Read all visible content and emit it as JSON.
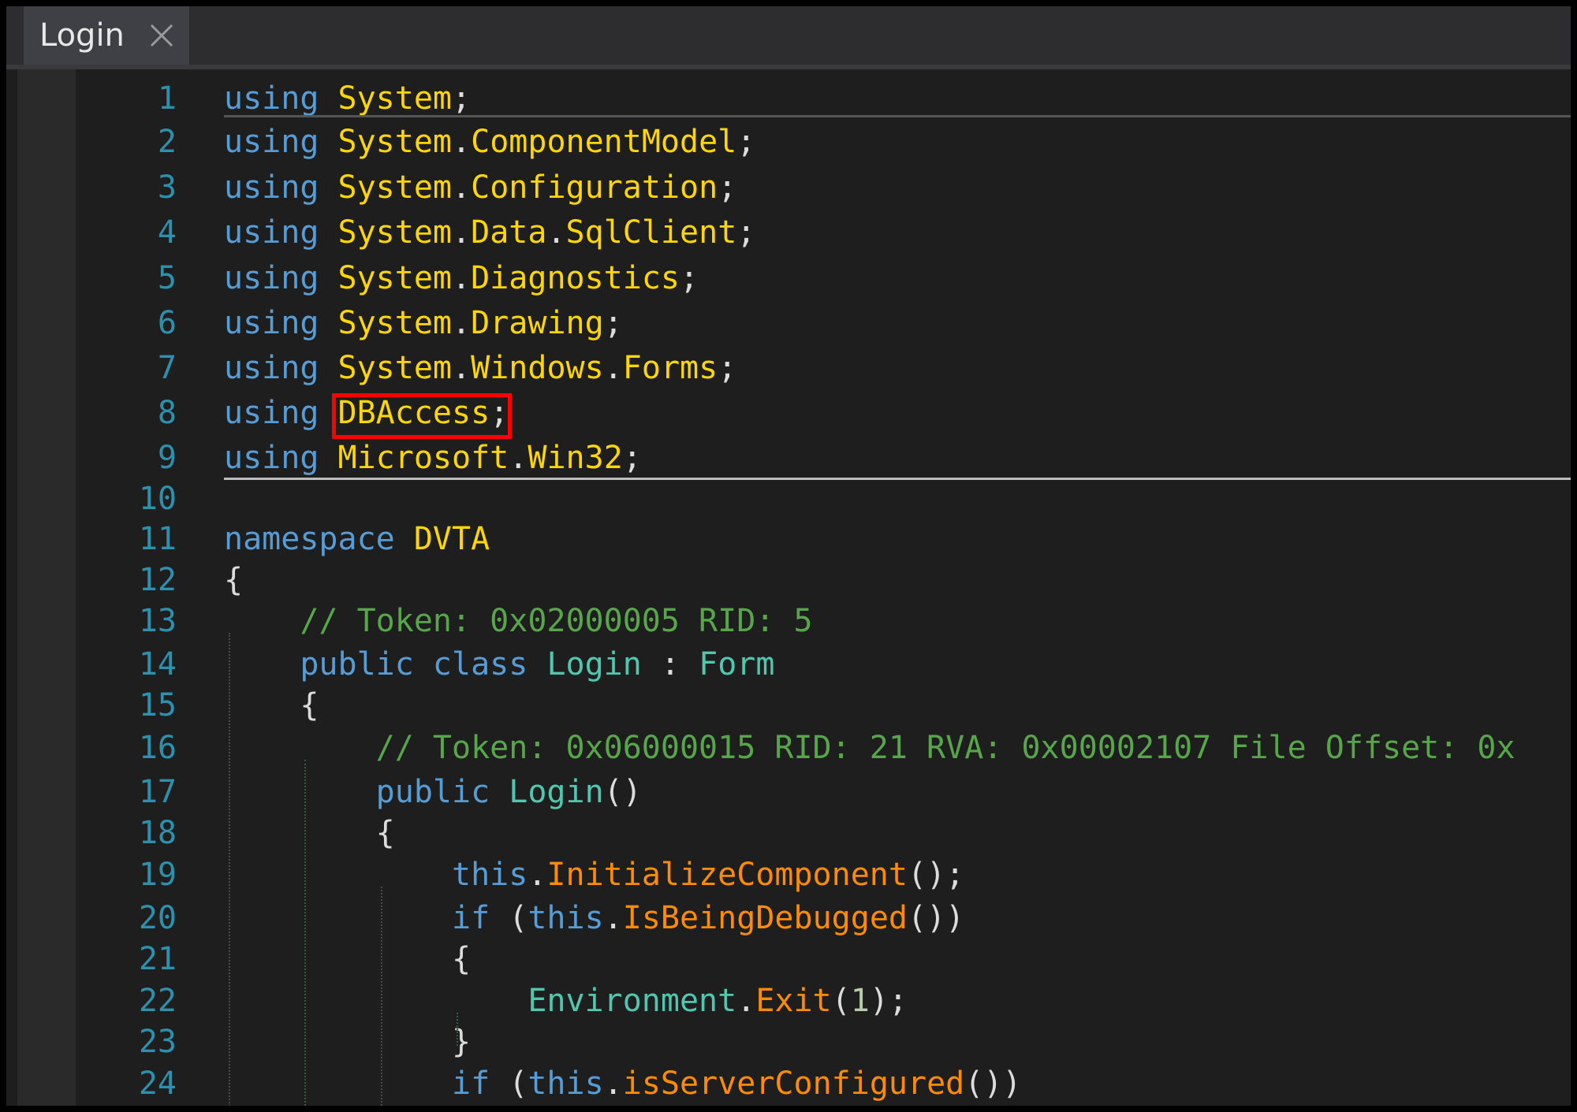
{
  "tab": {
    "label": "Login",
    "close_icon": "close-icon"
  },
  "lines": [
    {
      "n": "1",
      "tokens": [
        [
          "kw",
          "using"
        ],
        [
          "punct",
          " "
        ],
        [
          "ns",
          "System"
        ],
        [
          "punct",
          ";"
        ]
      ]
    },
    {
      "n": "2",
      "tokens": [
        [
          "kw",
          "using"
        ],
        [
          "punct",
          " "
        ],
        [
          "ns",
          "System"
        ],
        [
          "punct",
          "."
        ],
        [
          "ns",
          "ComponentModel"
        ],
        [
          "punct",
          ";"
        ]
      ]
    },
    {
      "n": "3",
      "tokens": [
        [
          "kw",
          "using"
        ],
        [
          "punct",
          " "
        ],
        [
          "ns",
          "System"
        ],
        [
          "punct",
          "."
        ],
        [
          "ns",
          "Configuration"
        ],
        [
          "punct",
          ";"
        ]
      ]
    },
    {
      "n": "4",
      "tokens": [
        [
          "kw",
          "using"
        ],
        [
          "punct",
          " "
        ],
        [
          "ns",
          "System"
        ],
        [
          "punct",
          "."
        ],
        [
          "ns",
          "Data"
        ],
        [
          "punct",
          "."
        ],
        [
          "ns",
          "SqlClient"
        ],
        [
          "punct",
          ";"
        ]
      ]
    },
    {
      "n": "5",
      "tokens": [
        [
          "kw",
          "using"
        ],
        [
          "punct",
          " "
        ],
        [
          "ns",
          "System"
        ],
        [
          "punct",
          "."
        ],
        [
          "ns",
          "Diagnostics"
        ],
        [
          "punct",
          ";"
        ]
      ]
    },
    {
      "n": "6",
      "tokens": [
        [
          "kw",
          "using"
        ],
        [
          "punct",
          " "
        ],
        [
          "ns",
          "System"
        ],
        [
          "punct",
          "."
        ],
        [
          "ns",
          "Drawing"
        ],
        [
          "punct",
          ";"
        ]
      ]
    },
    {
      "n": "7",
      "tokens": [
        [
          "kw",
          "using"
        ],
        [
          "punct",
          " "
        ],
        [
          "ns",
          "System"
        ],
        [
          "punct",
          "."
        ],
        [
          "ns",
          "Windows"
        ],
        [
          "punct",
          "."
        ],
        [
          "ns",
          "Forms"
        ],
        [
          "punct",
          ";"
        ]
      ]
    },
    {
      "n": "8",
      "tokens": [
        [
          "kw",
          "using"
        ],
        [
          "punct",
          " "
        ],
        [
          "ns",
          "DBAccess"
        ],
        [
          "punct",
          ";"
        ]
      ]
    },
    {
      "n": "9",
      "tokens": [
        [
          "kw",
          "using"
        ],
        [
          "punct",
          " "
        ],
        [
          "ns",
          "Microsoft"
        ],
        [
          "punct",
          "."
        ],
        [
          "ns",
          "Win32"
        ],
        [
          "punct",
          ";"
        ]
      ]
    },
    {
      "n": "10",
      "tokens": []
    },
    {
      "n": "11",
      "tokens": [
        [
          "kw",
          "namespace"
        ],
        [
          "punct",
          " "
        ],
        [
          "ns",
          "DVTA"
        ]
      ]
    },
    {
      "n": "12",
      "tokens": [
        [
          "punct",
          "{"
        ]
      ]
    },
    {
      "n": "13",
      "tokens": [
        [
          "punct",
          "    "
        ],
        [
          "cm",
          "// Token: 0x02000005 RID: 5"
        ]
      ]
    },
    {
      "n": "14",
      "tokens": [
        [
          "punct",
          "    "
        ],
        [
          "kw",
          "public"
        ],
        [
          "punct",
          " "
        ],
        [
          "kw",
          "class"
        ],
        [
          "punct",
          " "
        ],
        [
          "type",
          "Login"
        ],
        [
          "punct",
          " : "
        ],
        [
          "type",
          "Form"
        ]
      ]
    },
    {
      "n": "15",
      "tokens": [
        [
          "punct",
          "    {"
        ]
      ]
    },
    {
      "n": "16",
      "tokens": [
        [
          "punct",
          "        "
        ],
        [
          "cm",
          "// Token: 0x06000015 RID: 21 RVA: 0x00002107 File Offset: 0x"
        ]
      ]
    },
    {
      "n": "17",
      "tokens": [
        [
          "punct",
          "        "
        ],
        [
          "kw",
          "public"
        ],
        [
          "punct",
          " "
        ],
        [
          "type",
          "Login"
        ],
        [
          "punct",
          "()"
        ]
      ]
    },
    {
      "n": "18",
      "tokens": [
        [
          "punct",
          "        {"
        ]
      ]
    },
    {
      "n": "19",
      "tokens": [
        [
          "punct",
          "            "
        ],
        [
          "kw",
          "this"
        ],
        [
          "punct",
          "."
        ],
        [
          "method",
          "InitializeComponent"
        ],
        [
          "punct",
          "();"
        ]
      ]
    },
    {
      "n": "20",
      "tokens": [
        [
          "punct",
          "            "
        ],
        [
          "kw",
          "if"
        ],
        [
          "punct",
          " ("
        ],
        [
          "kw",
          "this"
        ],
        [
          "punct",
          "."
        ],
        [
          "method",
          "IsBeingDebugged"
        ],
        [
          "punct",
          "())"
        ]
      ]
    },
    {
      "n": "21",
      "tokens": [
        [
          "punct",
          "            {"
        ]
      ]
    },
    {
      "n": "22",
      "tokens": [
        [
          "punct",
          "                "
        ],
        [
          "env",
          "Environment"
        ],
        [
          "punct",
          "."
        ],
        [
          "method",
          "Exit"
        ],
        [
          "punct",
          "("
        ],
        [
          "num",
          "1"
        ],
        [
          "punct",
          ");"
        ]
      ]
    },
    {
      "n": "23",
      "tokens": [
        [
          "punct",
          "            }"
        ]
      ]
    },
    {
      "n": "24",
      "tokens": [
        [
          "punct",
          "            "
        ],
        [
          "kw",
          "if"
        ],
        [
          "punct",
          " ("
        ],
        [
          "kw",
          "this"
        ],
        [
          "punct",
          "."
        ],
        [
          "method",
          "isServerConfigured"
        ],
        [
          "punct",
          "())"
        ]
      ]
    }
  ]
}
